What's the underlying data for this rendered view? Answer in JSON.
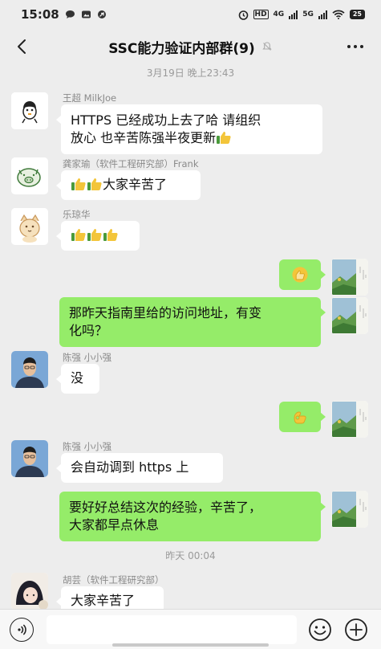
{
  "status_bar": {
    "time": "15:08",
    "network_labels": [
      "HD",
      "4G",
      "5G"
    ],
    "battery": "25"
  },
  "header": {
    "title": "SSC能力验证内部群(9)"
  },
  "timestamps": [
    "3月19日 晚上23:43",
    "昨天 00:04"
  ],
  "messages": [
    {
      "sender": "王超  MilkJoe",
      "text": "HTTPS 已经成功上去了哈 请组织",
      "text2": "放心 也辛苦陈强半夜更新"
    },
    {
      "sender": "龚家瑜（软件工程研究部）Frank",
      "text": "大家辛苦了"
    },
    {
      "sender": "乐琼华"
    },
    {
      "sticker": "thumbs-up"
    },
    {
      "text": "那昨天指南里给的访问地址，有变",
      "text2": "化吗？"
    },
    {
      "sender": "陈强  小小强",
      "text": "没"
    },
    {
      "sticker": "ok-hand"
    },
    {
      "sender": "陈强  小小强",
      "text": "会自动调到 https 上"
    },
    {
      "text": "要好好总结这次的经验，辛苦了，",
      "text2": "大家都早点休息"
    },
    {
      "sender": "胡芸（软件工程研究部）",
      "text": "大家辛苦了"
    }
  ],
  "colors": {
    "background": "#ededed",
    "incoming_bubble": "#ffffff",
    "outgoing_bubble": "#95ec69",
    "timestamp_text": "#9a9a9a"
  }
}
